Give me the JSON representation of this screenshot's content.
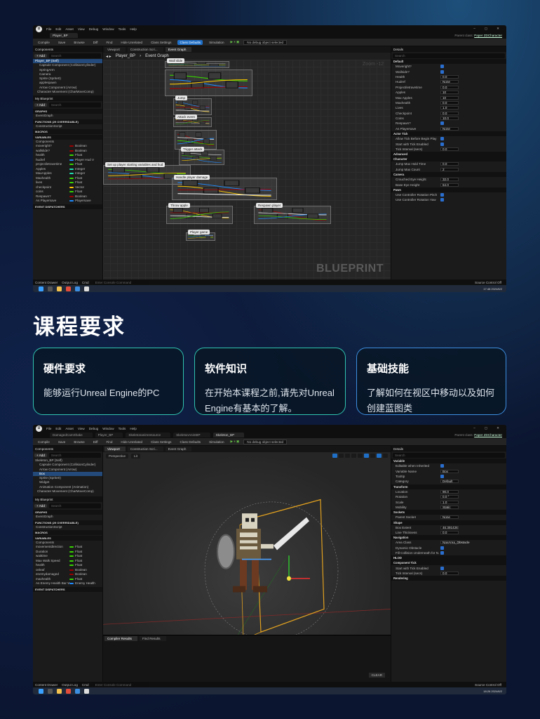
{
  "screenshot1": {
    "menu": [
      "File",
      "Edit",
      "Asset",
      "View",
      "Debug",
      "Window",
      "Tools",
      "Help"
    ],
    "doc_tabs": [
      "Player_BP"
    ],
    "parent_class_label": "Parent class:",
    "parent_class_value": "Paper ZDCharacter",
    "toolbar": {
      "compile": "Compile",
      "save": "Save",
      "browse": "Browse",
      "diff": "Diff",
      "find": "Find",
      "hide_unrelated": "Hide Unrelated",
      "class_settings": "Class Settings",
      "class_defaults": "Class Defaults",
      "simulation": "Simulation",
      "debug_select": "No debug object selected"
    },
    "components_title": "Components",
    "add": "+ Add",
    "search_placeholder": "Search",
    "components": [
      "Player_BP (Self)",
      "Capsule Component (CollisionCylinder)",
      "SpringArm",
      "Camera",
      "Sprite (Sprite0)",
      "applespawn",
      "Arrow Component (Arrow)",
      "Character Movement (CharMoveComp)"
    ],
    "edit_in_cpp": "Edit in C++",
    "myblueprint_title": "My Blueprint",
    "sections": {
      "graphs": "GRAPHS",
      "functions": "FUNCTIONS",
      "functions_count": "(29 OVERRIDABLE)",
      "macros": "MACROS",
      "variables": "VARIABLES",
      "dispatchers": "EVENT DISPATCHERS"
    },
    "graph_items": {
      "event_graph": "EventGraph",
      "construction": "ConstructionScript",
      "components": "Components"
    },
    "variables": [
      {
        "name": "moveright?",
        "type": "Boolean",
        "color": "#9b0000"
      },
      {
        "name": "wallslide?",
        "type": "Boolean",
        "color": "#9b0000"
      },
      {
        "name": "health",
        "type": "Float",
        "color": "#38d500"
      },
      {
        "name": "hudref",
        "type": "Player Hud V",
        "color": "#1f8cff"
      },
      {
        "name": "projectiletravetime",
        "type": "Float",
        "color": "#38d500"
      },
      {
        "name": "Apples",
        "type": "Integer",
        "color": "#1fe0b0"
      },
      {
        "name": "MaxApples",
        "type": "Integer",
        "color": "#1fe0b0"
      },
      {
        "name": "Maxhealth",
        "type": "Float",
        "color": "#38d500"
      },
      {
        "name": "lives",
        "type": "Float",
        "color": "#38d500"
      },
      {
        "name": "checkpoint",
        "type": "Vector",
        "color": "#ffc800"
      },
      {
        "name": "coins",
        "type": "Float",
        "color": "#38d500"
      },
      {
        "name": "Respawn?",
        "type": "Boolean",
        "color": "#9b0000"
      },
      {
        "name": "As Playersave",
        "type": "Playersave",
        "color": "#1f8cff"
      }
    ],
    "viewport_tabs": [
      "Viewport",
      "Construction Scri...",
      "Event Graph"
    ],
    "breadcrumb": [
      "Player_BP",
      "Event Graph"
    ],
    "zoom": "Zoom -12",
    "comments": [
      "Wall slide",
      "Jump",
      "Attack event",
      "Trigger attack",
      "Set up player starting variables and hud",
      "Handle player damage",
      "Throw apple",
      "Respawn player",
      "Player game"
    ],
    "watermark": "BLUEPRINT",
    "details_title": "Details",
    "details_sections": {
      "default": "Default",
      "actor_tick": "Actor Tick",
      "advanced": "Advanced",
      "character": "Character",
      "camera": "Camera",
      "pawn": "Pawn"
    },
    "details_rows": [
      {
        "label": "Moveright?",
        "value": ""
      },
      {
        "label": "Wallside?",
        "value": ""
      },
      {
        "label": "Health",
        "value": "0.0"
      },
      {
        "label": "Hudref",
        "value": "None"
      },
      {
        "label": "Projectiletravetime",
        "value": "0.0"
      },
      {
        "label": "Apples",
        "value": "10"
      },
      {
        "label": "Max Apples",
        "value": "10"
      },
      {
        "label": "Maxhealth",
        "value": "0.0"
      },
      {
        "label": "Lives",
        "value": "1.0"
      },
      {
        "label": "Checkpoint",
        "value": "0.0"
      },
      {
        "label": "Coins",
        "value": "10.0"
      },
      {
        "label": "Respawn?",
        "value": ""
      },
      {
        "label": "As Playersave",
        "value": "None"
      }
    ],
    "tick_rows": [
      {
        "label": "Allow Tick Before Begin Play",
        "value": ""
      },
      {
        "label": "Start with Tick Enabled",
        "value": ""
      },
      {
        "label": "Tick Interval (secs)",
        "value": "0.0"
      }
    ],
    "character_rows": [
      {
        "label": "Jump Max Hold Time",
        "value": "0.0"
      },
      {
        "label": "Jump Max Count",
        "value": "2"
      }
    ],
    "camera_rows": [
      {
        "label": "Crouched Eye Height",
        "value": "32.0"
      },
      {
        "label": "Base Eye Height",
        "value": "64.0"
      }
    ],
    "pawn_rows": [
      {
        "label": "Use Controller Rotation Pitch",
        "value": ""
      },
      {
        "label": "Use Controller Rotation Yaw",
        "value": ""
      }
    ],
    "status": {
      "content_drawer": "Content Drawer",
      "output_log": "Output Log",
      "cmd": "Cmd",
      "console_placeholder": "Enter Console Command",
      "source_control": "Source Control Off"
    },
    "clock": {
      "time": "17:48",
      "date": "2024/6/2"
    }
  },
  "section": {
    "title": "课程要求",
    "cards": [
      {
        "title": "硬件要求",
        "body": "能够运行Unreal Engine的PC"
      },
      {
        "title": "软件知识",
        "body": "在开始本课程之前,请先对Unreal Engine有基本的了解。"
      },
      {
        "title": "基础技能",
        "body": "了解如何在视区中移动以及如何创建蓝图类"
      }
    ]
  },
  "screenshot2": {
    "doc_tabs": [
      "DamagedCamShake",
      "Player_BP",
      "Skeletonanimresource",
      "SkeletonAnimBP",
      "Skeleton_BP"
    ],
    "components": [
      "Skeleton_BP (Self)",
      "Capsule Component (CollisionCylinder)",
      "Arrow Component (Arrow)",
      "Box",
      "Sprite (Sprite0)",
      "Widget",
      "Animation Component (Animation)",
      "Character Movement (CharMoveComp)"
    ],
    "variables": [
      {
        "name": "movementdirection",
        "type": "Float",
        "color": "#38d500"
      },
      {
        "name": "Duration",
        "type": "Float",
        "color": "#38d500"
      },
      {
        "name": "waittime",
        "type": "Float",
        "color": "#38d500"
      },
      {
        "name": "Max Walk Speed",
        "type": "Float",
        "color": "#38d500"
      },
      {
        "name": "health",
        "type": "Float",
        "color": "#38d500"
      },
      {
        "name": "onleaf",
        "type": "Boolean",
        "color": "#9b0000"
      },
      {
        "name": "enemydamaged",
        "type": "Boolean",
        "color": "#9b0000"
      },
      {
        "name": "maxhealth",
        "type": "Float",
        "color": "#38d500"
      },
      {
        "name": "As Enemy Health Bar WB",
        "type": "Enemy Health",
        "color": "#1f8cff"
      }
    ],
    "viewport_labels": [
      "Perspective",
      "Lit"
    ],
    "details_sections": {
      "variable": "Variable",
      "transform": "Transform",
      "sockets": "Sockets",
      "shape": "Shape",
      "navigation": "Navigation",
      "hlod": "HLOD",
      "component_tick": "Component Tick",
      "rendering": "Rendering"
    },
    "detail_rows": [
      {
        "label": "Editable when Inherited",
        "value": ""
      },
      {
        "label": "Variable Name",
        "value": "Box"
      },
      {
        "label": "Tooltip",
        "value": ""
      },
      {
        "label": "Category",
        "value": "Default"
      }
    ],
    "transform_rows": [
      {
        "label": "Location",
        "value": "90.0"
      },
      {
        "label": "Rotation",
        "value": "0.0 °"
      },
      {
        "label": "Scale",
        "value": "1.0"
      },
      {
        "label": "Mobility",
        "value": "Static"
      }
    ],
    "shape_rows": [
      {
        "label": "Box Extent",
        "value": "46.391426"
      },
      {
        "label": "Line Thickness",
        "value": "0.0"
      }
    ],
    "nav_rows": [
      {
        "label": "Area Class",
        "value": "NavArea_Obstacle"
      },
      {
        "label": "Dynamic Obstacle",
        "value": ""
      },
      {
        "label": "Fill Collision Underneath for N...",
        "value": ""
      }
    ],
    "tick_rows": [
      {
        "label": "Start with Tick Enabled",
        "value": ""
      },
      {
        "label": "Tick Interval (secs)",
        "value": "0.0"
      }
    ],
    "parent_socket": "Parent Socket",
    "parent_socket_value": "None",
    "compiler_results": "Compiler Results",
    "find_results": "Find Results",
    "clear": "CLEAR",
    "clock": {
      "time": "18:26",
      "date": "2024/6/2"
    }
  }
}
